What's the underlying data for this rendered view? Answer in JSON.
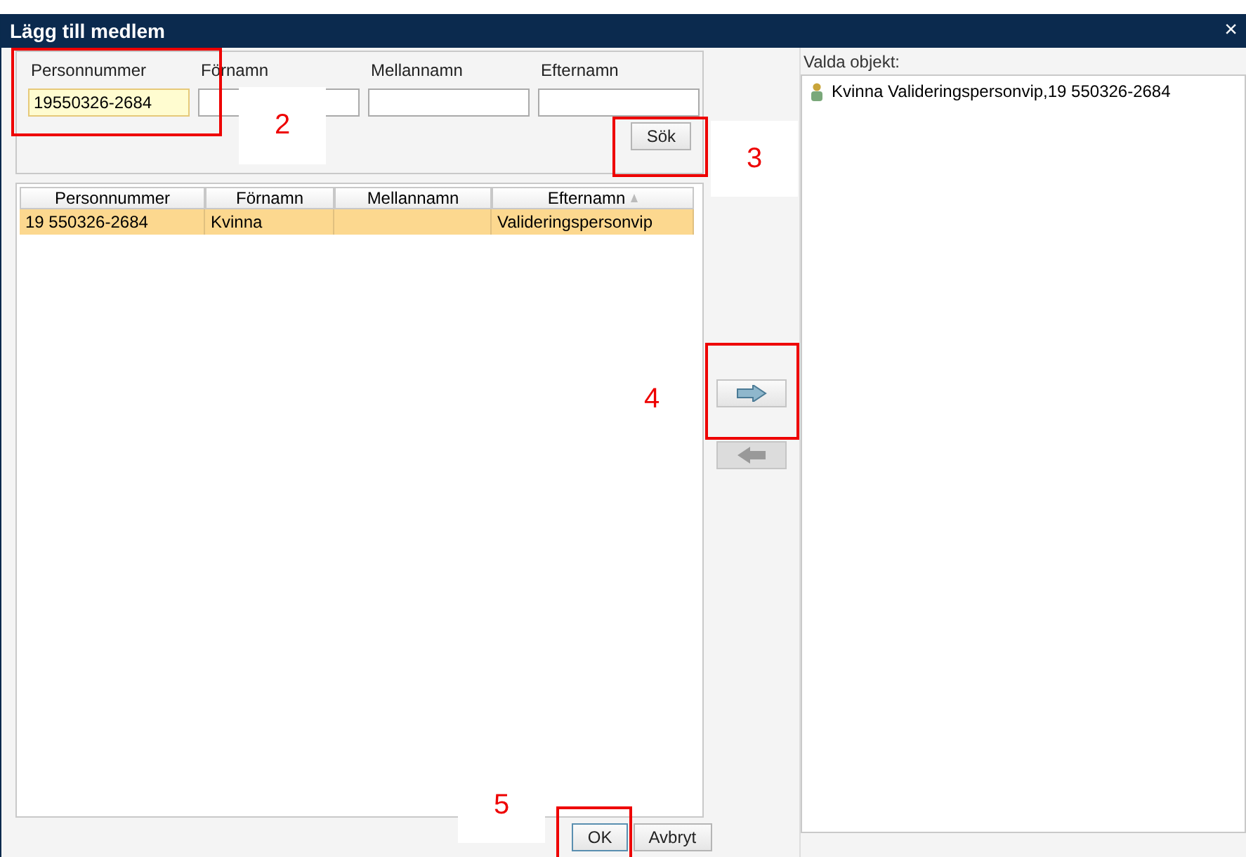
{
  "window": {
    "title": "Lägg till medlem",
    "close": "×"
  },
  "search": {
    "fields": [
      {
        "label": "Personnummer",
        "value": "19550326-2684",
        "focused": true
      },
      {
        "label": "Förnamn",
        "focused": false
      },
      {
        "label": "Mellannamn",
        "focused": false
      },
      {
        "label": "Efternamn",
        "focused": false
      }
    ],
    "button": "Sök"
  },
  "table": {
    "columns": [
      {
        "label": "Personnummer",
        "sorted": false
      },
      {
        "label": "Förnamn",
        "sorted": false
      },
      {
        "label": "Mellannamn",
        "sorted": false
      },
      {
        "label": "Efternamn",
        "sorted": true
      }
    ],
    "rows": [
      {
        "cells": [
          "19 550326-2684",
          "Kvinna",
          "",
          "Valideringspersonvip"
        ],
        "selected": true
      }
    ]
  },
  "transfer_buttons": [
    {
      "kind": "right",
      "disabled": false
    },
    {
      "kind": "left",
      "disabled": true
    }
  ],
  "selected_panel": {
    "label": "Valda objekt:",
    "items": [
      "Kvinna Valideringspersonvip,19 550326-2684"
    ]
  },
  "buttons": [
    {
      "label": "OK",
      "focused": true
    },
    {
      "label": "Avbryt",
      "focused": false
    }
  ],
  "annotations": [
    {
      "label": "2",
      "kind": "field"
    },
    {
      "label": "3",
      "kind": "search"
    },
    {
      "label": "4",
      "kind": "transfer"
    },
    {
      "label": "5",
      "kind": "ok"
    }
  ]
}
